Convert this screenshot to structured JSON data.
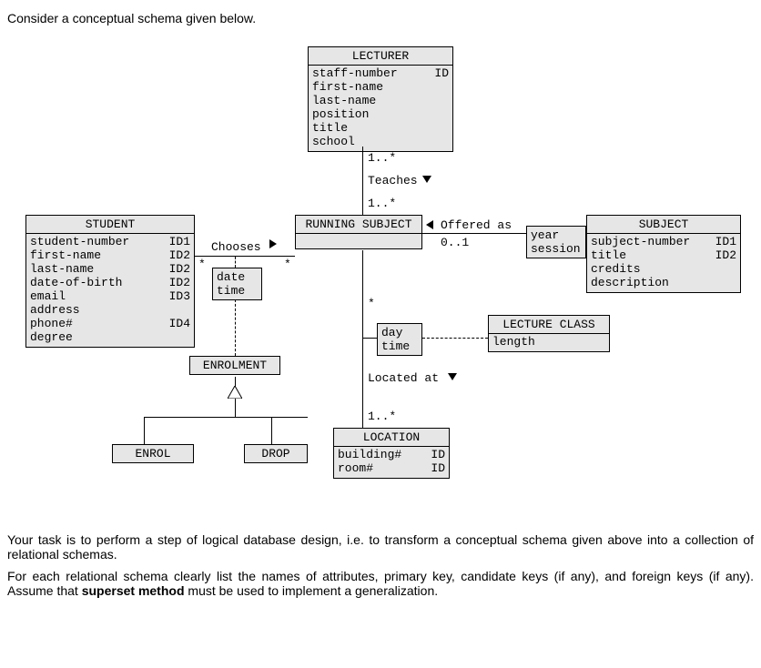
{
  "intro": "Consider a conceptual schema given below.",
  "outro1": "Your task is to perform a step of logical database design, i.e. to transform a conceptual schema given above into a collection of relational schemas.",
  "outro2": "For each relational schema clearly list the names of attributes, primary key, candidate keys (if any), and foreign keys (if any). Assume that ",
  "outro2_bold": "superset method",
  "outro2_tail": " must be used to implement a generalization.",
  "entities": {
    "lecturer": {
      "title": "LECTURER",
      "attrs": [
        {
          "name": "staff-number",
          "tag": "ID"
        },
        {
          "name": "first-name",
          "tag": ""
        },
        {
          "name": "last-name",
          "tag": ""
        },
        {
          "name": "position",
          "tag": ""
        },
        {
          "name": "title",
          "tag": ""
        },
        {
          "name": "school",
          "tag": ""
        }
      ]
    },
    "student": {
      "title": "STUDENT",
      "attrs": [
        {
          "name": "student-number",
          "tag": "ID1"
        },
        {
          "name": "first-name",
          "tag": "ID2"
        },
        {
          "name": "last-name",
          "tag": "ID2"
        },
        {
          "name": "date-of-birth",
          "tag": "ID2"
        },
        {
          "name": "email",
          "tag": "ID3"
        },
        {
          "name": "address",
          "tag": ""
        },
        {
          "name": "phone#",
          "tag": "ID4"
        },
        {
          "name": "degree",
          "tag": ""
        }
      ]
    },
    "running_subject": {
      "title": "RUNNING SUBJECT"
    },
    "subject": {
      "title": "SUBJECT",
      "attrs": [
        {
          "name": "subject-number",
          "tag": "ID1"
        },
        {
          "name": "title",
          "tag": "ID2"
        },
        {
          "name": "credits",
          "tag": ""
        },
        {
          "name": "description",
          "tag": ""
        }
      ]
    },
    "lecture_class": {
      "title": "LECTURE CLASS",
      "attrs": [
        {
          "name": "length",
          "tag": ""
        }
      ]
    },
    "location": {
      "title": "LOCATION",
      "attrs": [
        {
          "name": "building#",
          "tag": "ID"
        },
        {
          "name": "room#",
          "tag": "ID"
        }
      ]
    },
    "enrolment": {
      "title": "ENROLMENT"
    },
    "enrol": {
      "title": "ENROL"
    },
    "drop": {
      "title": "DROP"
    }
  },
  "assoc": {
    "chooses": {
      "a1": "date",
      "a2": "time"
    },
    "daytime": {
      "a1": "day",
      "a2": "time"
    }
  },
  "qualifiers": {
    "year_session": {
      "l1": "year",
      "l2": "session"
    }
  },
  "labels": {
    "teaches": "Teaches",
    "teaches_m1": "1..*",
    "teaches_m2": "1..*",
    "chooses": "Chooses",
    "chooses_m1": "*",
    "chooses_m2": "*",
    "offered_as": "Offered as",
    "offered_m": "0..1",
    "located_at": "Located at",
    "located_m": "1..*",
    "star": "*"
  }
}
